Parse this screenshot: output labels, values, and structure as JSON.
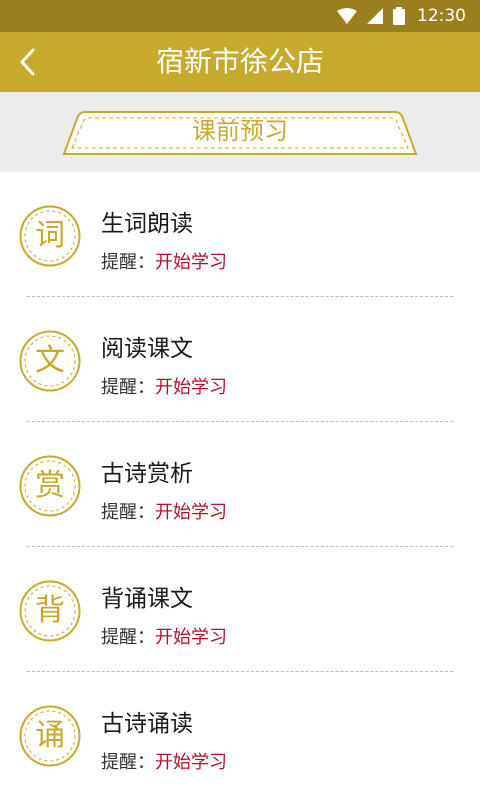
{
  "status_bar": {
    "time": "12:30"
  },
  "app_bar": {
    "title": "宿新市徐公店"
  },
  "section": {
    "label": "课前预习"
  },
  "items": [
    {
      "badge": "词",
      "title": "生词朗读",
      "reminder_label": "提醒：",
      "reminder_action": "开始学习"
    },
    {
      "badge": "文",
      "title": "阅读课文",
      "reminder_label": "提醒：",
      "reminder_action": "开始学习"
    },
    {
      "badge": "赏",
      "title": "古诗赏析",
      "reminder_label": "提醒：",
      "reminder_action": "开始学习"
    },
    {
      "badge": "背",
      "title": "背诵课文",
      "reminder_label": "提醒：",
      "reminder_action": "开始学习"
    },
    {
      "badge": "诵",
      "title": "古诗诵读",
      "reminder_label": "提醒：",
      "reminder_action": "开始学习"
    }
  ],
  "colors": {
    "status_bar": "#9a7f1e",
    "app_bar": "#c7aa2c",
    "accent": "#c7aa2c",
    "action": "#b4122a",
    "band": "#ececec"
  }
}
